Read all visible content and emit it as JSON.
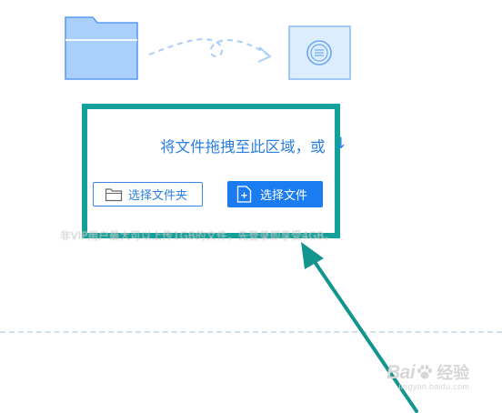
{
  "upload": {
    "prompt": "将文件拖拽至此区域，或",
    "prompt_arrow": "↓",
    "select_folder_label": "选择文件夹",
    "select_file_label": "选择文件",
    "hint": "非VIP用户最大可以上传1GB的文件，先登录即享受4GB。"
  },
  "watermark": {
    "brand": "Bai",
    "brand2": "经验",
    "site": "jingyan.baidu.com"
  },
  "colors": {
    "accent_blue": "#1a7cf0",
    "highlight_teal": "#14a09a",
    "folder_fill": "#aacffb",
    "folder_stroke": "#5b9cf0"
  },
  "icons": {
    "folder_illustration": "folder-icon",
    "convert_illustration": "convert-icon",
    "select_folder": "folder-outline-icon",
    "select_file": "file-add-icon",
    "watermark_paw": "paw-icon"
  }
}
